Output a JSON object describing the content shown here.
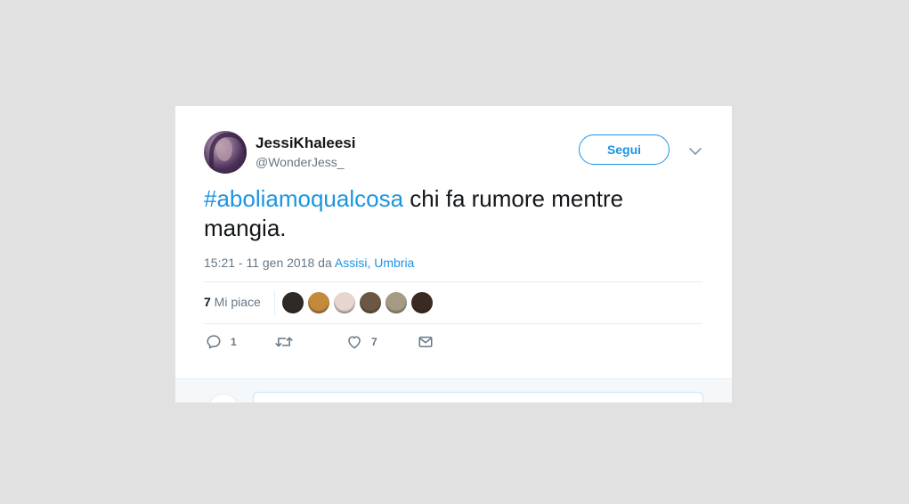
{
  "tweet": {
    "author": {
      "display_name": "JessiKhaleesi",
      "handle": "@WonderJess_"
    },
    "follow_label": "Segui",
    "hashtag": "#aboliamoqualcosa",
    "text": " chi fa rumore mentre mangia.",
    "timestamp": "15:21 - 11 gen 2018 da ",
    "location_city": "Assisi",
    "location_sep": ", ",
    "location_region": "Umbria",
    "likes": {
      "count": "7",
      "label": " Mi piace"
    },
    "liker_avatar_colors": [
      "#2e2a28",
      "#c48a3c",
      "#e7d6d0",
      "#6b5743",
      "#a59b84",
      "#3a2b22"
    ],
    "actions": {
      "reply_count": "1",
      "like_count": "7"
    }
  },
  "colors": {
    "accent": "#1b95e0",
    "muted": "#657786",
    "text": "#14171a",
    "background": "#e1e1e1"
  },
  "icons": [
    "reply-icon",
    "retweet-icon",
    "heart-icon",
    "direct-message-icon",
    "chevron-down-icon"
  ]
}
